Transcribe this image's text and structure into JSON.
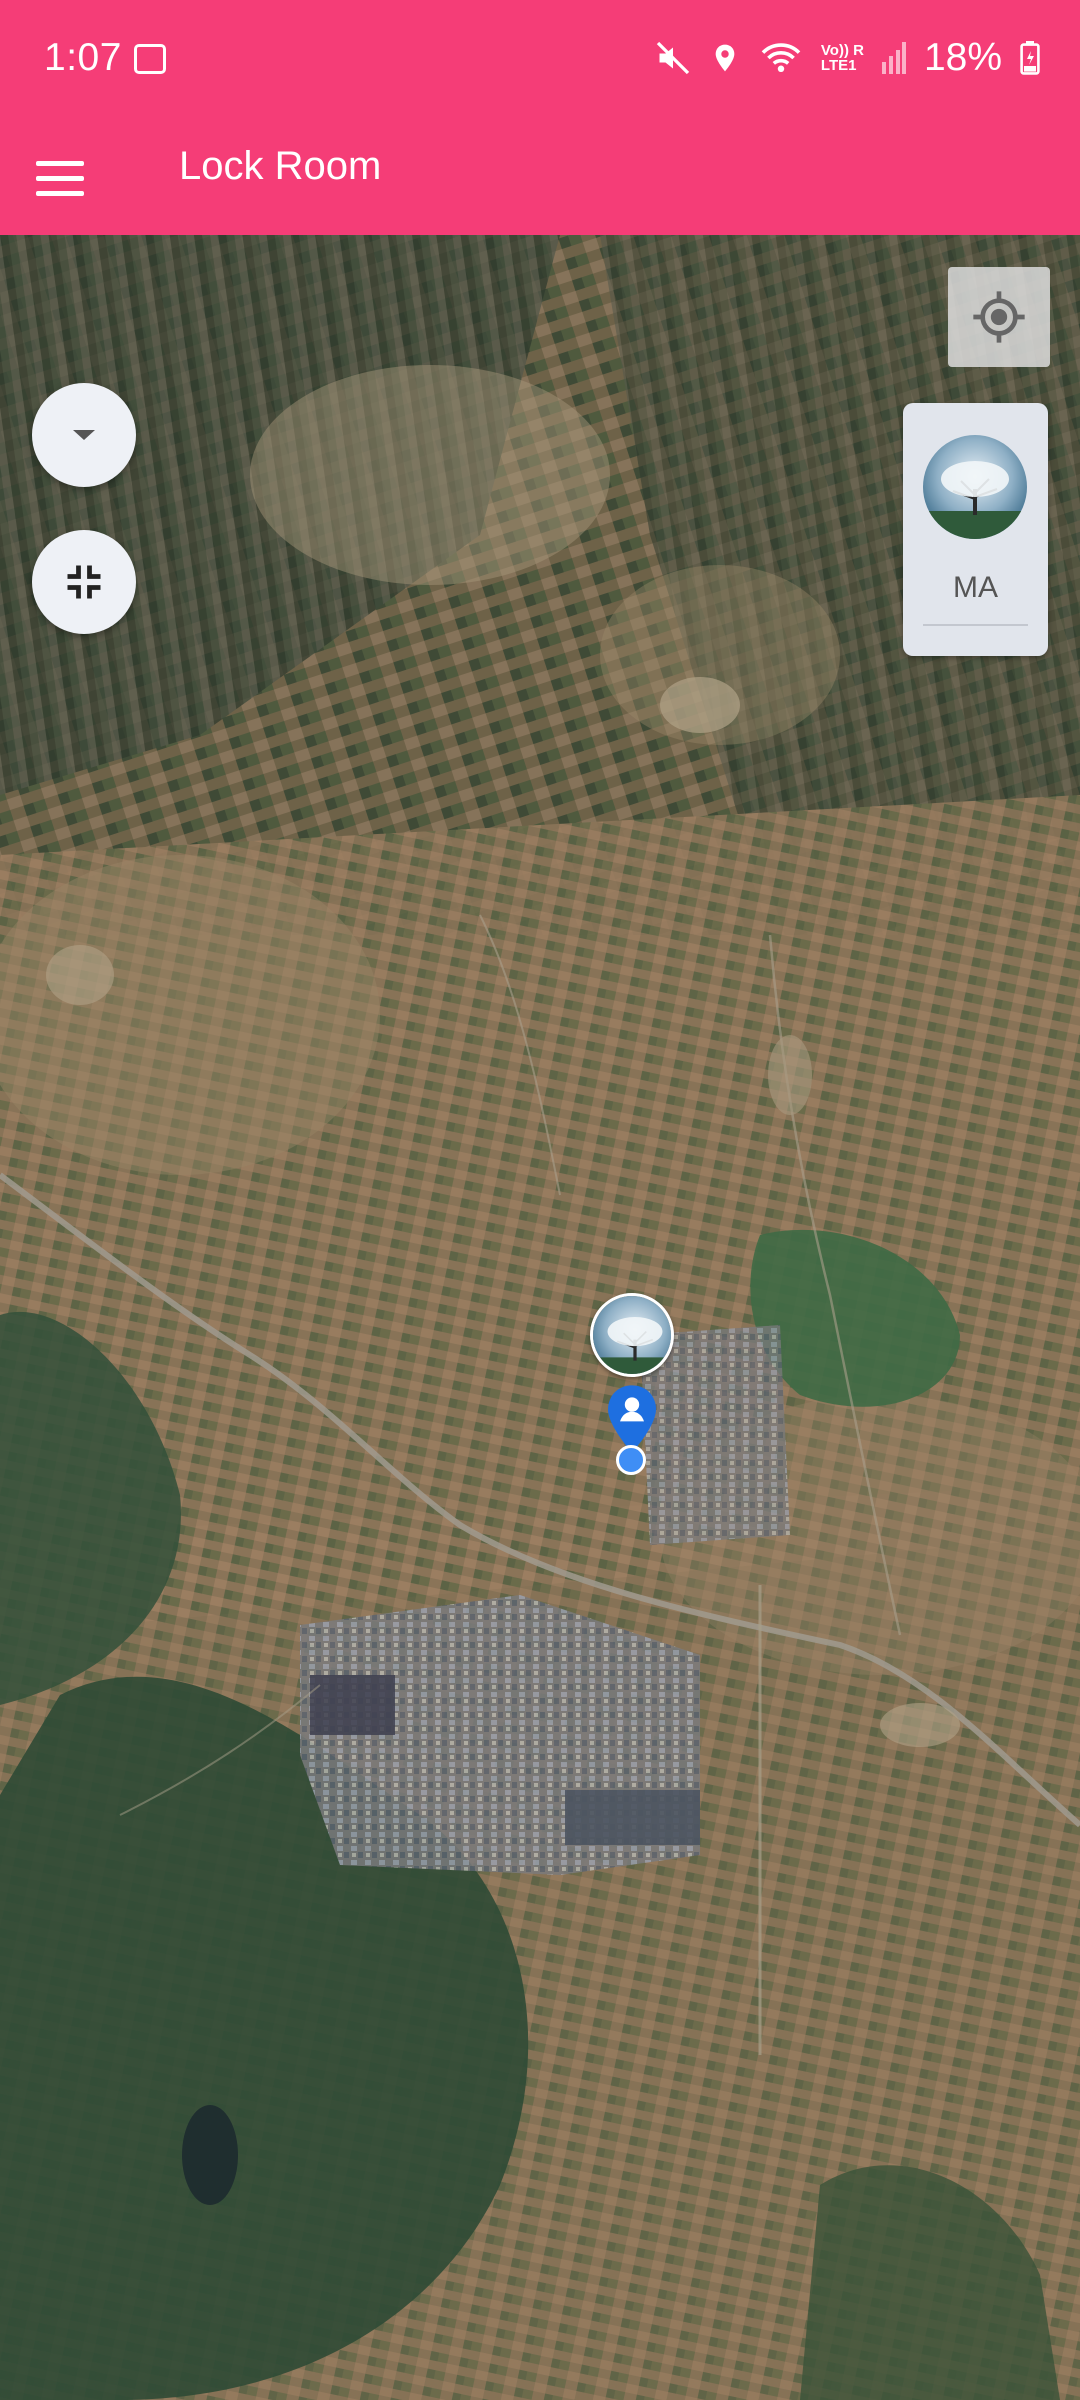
{
  "status_bar": {
    "time": "1:07",
    "battery": "18%",
    "network": "LTE1",
    "icons": [
      "gallery-icon",
      "mute-icon",
      "location-icon",
      "wifi-icon",
      "signal-icon",
      "battery-icon"
    ]
  },
  "toolbar": {
    "title": "Lock Room",
    "menu_icon": "hamburger-menu-icon"
  },
  "map": {
    "type": "satellite",
    "controls": {
      "layers_icon": "dropdown-arrow-icon",
      "fullscreen_icon": "collapse-icon",
      "locate_icon": "my-location-icon"
    },
    "member_panel": {
      "initials": "MA"
    }
  },
  "colors": {
    "appbar": "#f53d77",
    "pin": "#1e6fe0",
    "location_dot": "#3f8ef5"
  }
}
